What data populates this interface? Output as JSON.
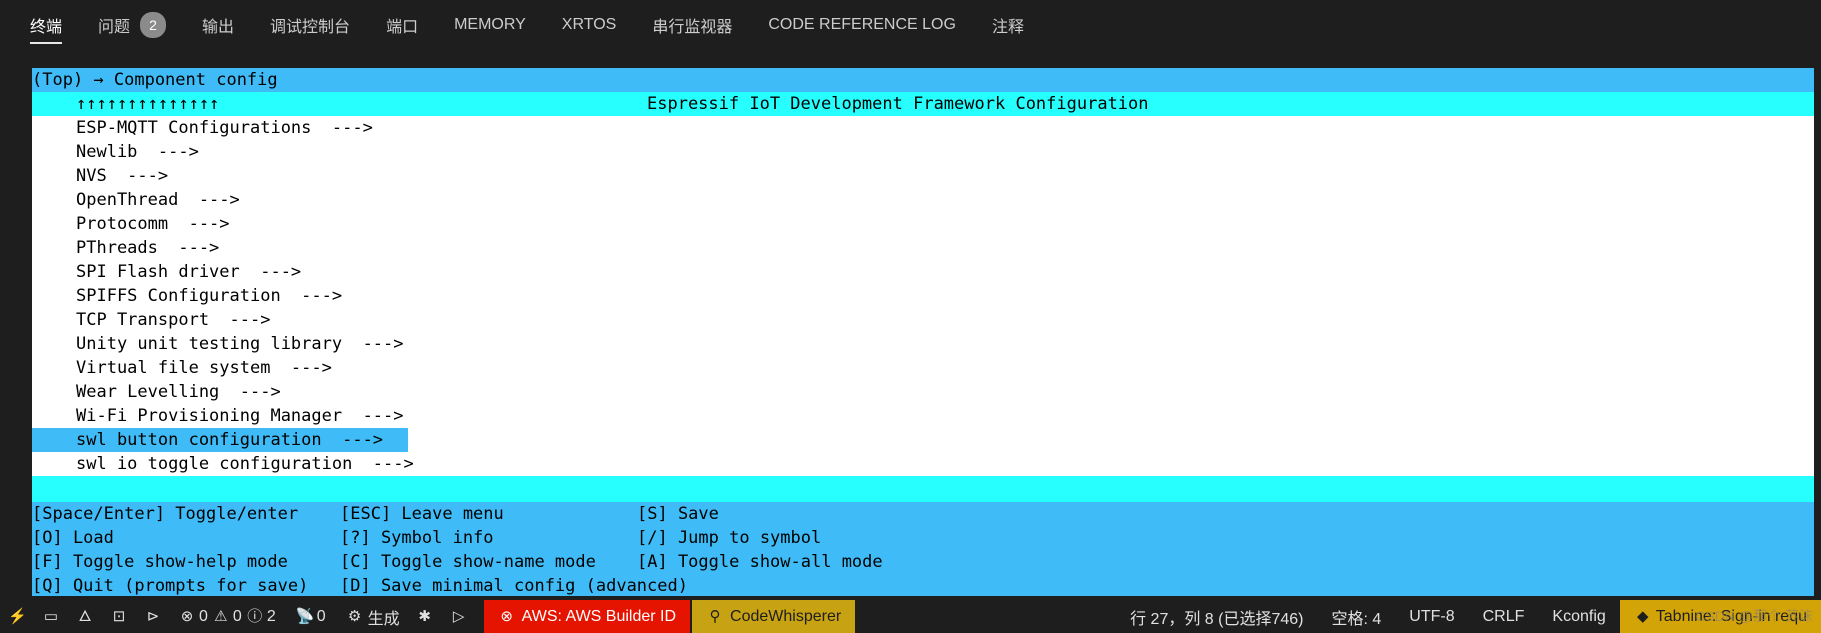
{
  "tabs": [
    {
      "label": "终端",
      "active": true
    },
    {
      "label": "问题",
      "badge": "2"
    },
    {
      "label": "输出"
    },
    {
      "label": "调试控制台"
    },
    {
      "label": "端口"
    },
    {
      "label": "MEMORY"
    },
    {
      "label": "XRTOS"
    },
    {
      "label": "串行监视器"
    },
    {
      "label": "CODE REFERENCE LOG"
    },
    {
      "label": "注释"
    }
  ],
  "terminal": {
    "breadcrumb": "(Top) → Component config",
    "frame_arrows": "↑↑↑↑↑↑↑↑↑↑↑↑↑↑",
    "frame_title": "Espressif IoT Development Framework Configuration",
    "items": [
      "ESP-MQTT Configurations  --->",
      "Newlib  --->",
      "NVS  --->",
      "OpenThread  --->",
      "Protocomm  --->",
      "PThreads  --->",
      "SPI Flash driver  --->",
      "SPIFFS Configuration  --->",
      "TCP Transport  --->",
      "Unity unit testing library  --->",
      "Virtual file system  --->",
      "Wear Levelling  --->",
      "Wi-Fi Provisioning Manager  --->",
      "swl button configuration  --->",
      "swl io toggle configuration  --->"
    ],
    "selected_index": 13,
    "help": [
      [
        "[Space/Enter] Toggle/enter",
        "[ESC] Leave menu",
        "[S] Save"
      ],
      [
        "[O] Load",
        "[?] Symbol info",
        "[/] Jump to symbol"
      ],
      [
        "[F] Toggle show-help mode",
        "[C] Toggle show-name mode",
        "[A] Toggle show-all mode"
      ],
      [
        "[Q] Quit (prompts for save)",
        "[D] Save minimal config (advanced)",
        ""
      ]
    ]
  },
  "statusbar": {
    "errors": "0",
    "warnings": "0",
    "infos": "2",
    "ports": "0",
    "build_label": "生成",
    "aws_label": "AWS: AWS Builder ID",
    "codewhisperer_label": "CodeWhisperer",
    "cursor_position": "行 27，列 8 (已选择746)",
    "indent": "空格: 4",
    "encoding": "UTF-8",
    "eol": "CRLF",
    "language": "Kconfig",
    "tabnine_label": "Tabnine: Sign-in requ",
    "watermark": "CSDN @那个 苏沫",
    "colors": {
      "terminal_blue": "#3fbcf7",
      "terminal_cyan": "#27fefe",
      "aws_red": "#e51400",
      "codewhisperer_yellow": "#c7a212"
    }
  }
}
